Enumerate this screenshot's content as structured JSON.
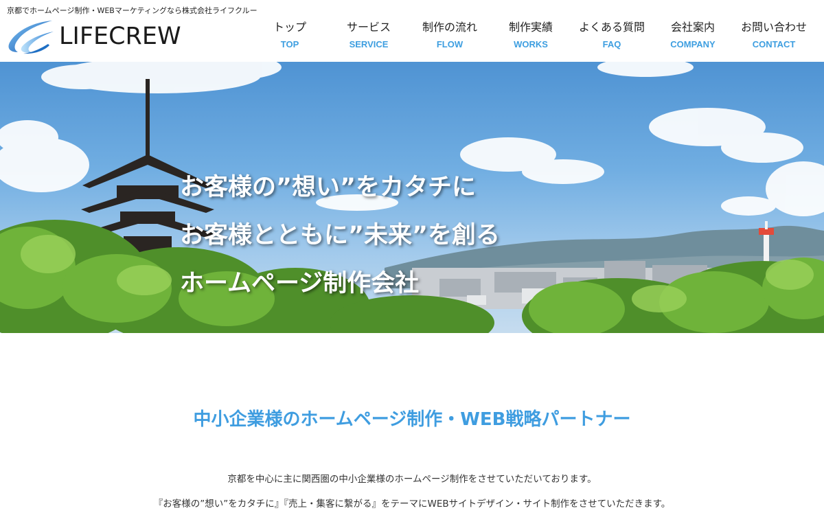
{
  "header": {
    "tagline": "京都でホームページ制作・WEBマーケティングなら株式会社ライフクルー",
    "logo_text": "LIFECREW"
  },
  "nav": [
    {
      "ja": "トップ",
      "en": "TOP"
    },
    {
      "ja": "サービス",
      "en": "SERVICE"
    },
    {
      "ja": "制作の流れ",
      "en": "FLOW"
    },
    {
      "ja": "制作実績",
      "en": "WORKS"
    },
    {
      "ja": "よくある質問",
      "en": "FAQ"
    },
    {
      "ja": "会社案内",
      "en": "COMPANY"
    },
    {
      "ja": "お問い合わせ",
      "en": "CONTACT"
    }
  ],
  "hero": {
    "lines": [
      "お客様の”想い”をカタチに",
      "お客様とともに”未来”を創る",
      "ホームページ制作会社"
    ]
  },
  "intro": {
    "title": "中小企業様のホームページ制作・WEB戦略パートナー",
    "paragraphs": [
      "京都を中心に主に関西圏の中小企業様のホームページ制作をさせていただいております。",
      "『お客様の”想い”をカタチに』『売上・集客に繋がる』をテーマにWEBサイトデザイン・サイト制作をさせていただきます。"
    ]
  },
  "colors": {
    "accent": "#3d9ee0",
    "title": "#3f9de0",
    "logo_blue": "#1f6fc4"
  },
  "icons": {
    "logo_mark": "swoosh-logo-icon"
  }
}
